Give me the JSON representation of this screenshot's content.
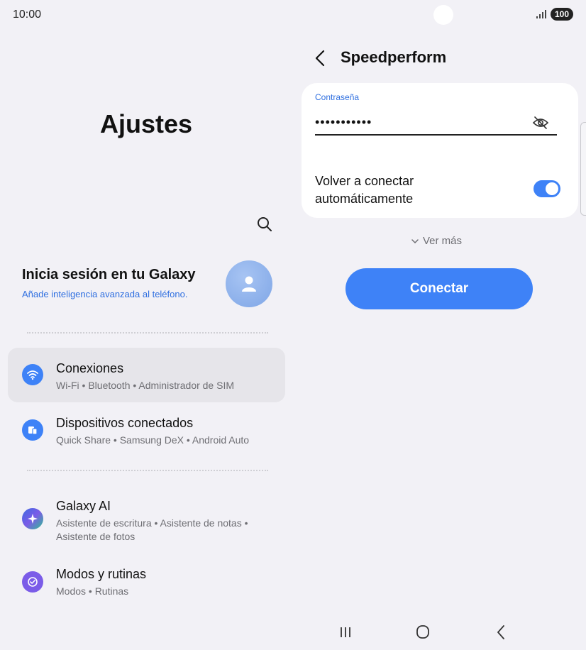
{
  "status_bar": {
    "time": "10:00",
    "battery": "100"
  },
  "settings": {
    "title": "Ajustes",
    "account": {
      "title": "Inicia sesión en tu Galaxy",
      "subtitle": "Añade inteligencia avanzada al teléfono."
    },
    "items": [
      {
        "title": "Conexiones",
        "subtitle": "Wi-Fi  •  Bluetooth  •  Administrador de SIM",
        "icon": "wifi-icon",
        "color": "#3e82f7"
      },
      {
        "title": "Dispositivos conectados",
        "subtitle": "Quick Share  •  Samsung DeX  •  Android Auto",
        "icon": "devices-icon",
        "color": "#3e82f7"
      },
      {
        "title": "Galaxy AI",
        "subtitle": "Asistente de escritura  •  Asistente de notas  •  Asistente de fotos",
        "icon": "sparkle-icon",
        "color": "#3d6be0"
      },
      {
        "title": "Modos y rutinas",
        "subtitle": "Modos  •  Rutinas",
        "icon": "routine-icon",
        "color": "#7b5ce8"
      }
    ]
  },
  "wifi_detail": {
    "network_name": "Speedperform",
    "password_label": "Contraseña",
    "password_value": "•••••••••••",
    "reconnect_label": "Volver a conectar automáticamente",
    "reconnect_enabled": true,
    "view_more": "Ver más",
    "connect_button": "Conectar"
  },
  "colors": {
    "accent": "#3e82f7",
    "background": "#f2f1f6",
    "card": "#ffffff",
    "link": "#2f6fe0"
  }
}
